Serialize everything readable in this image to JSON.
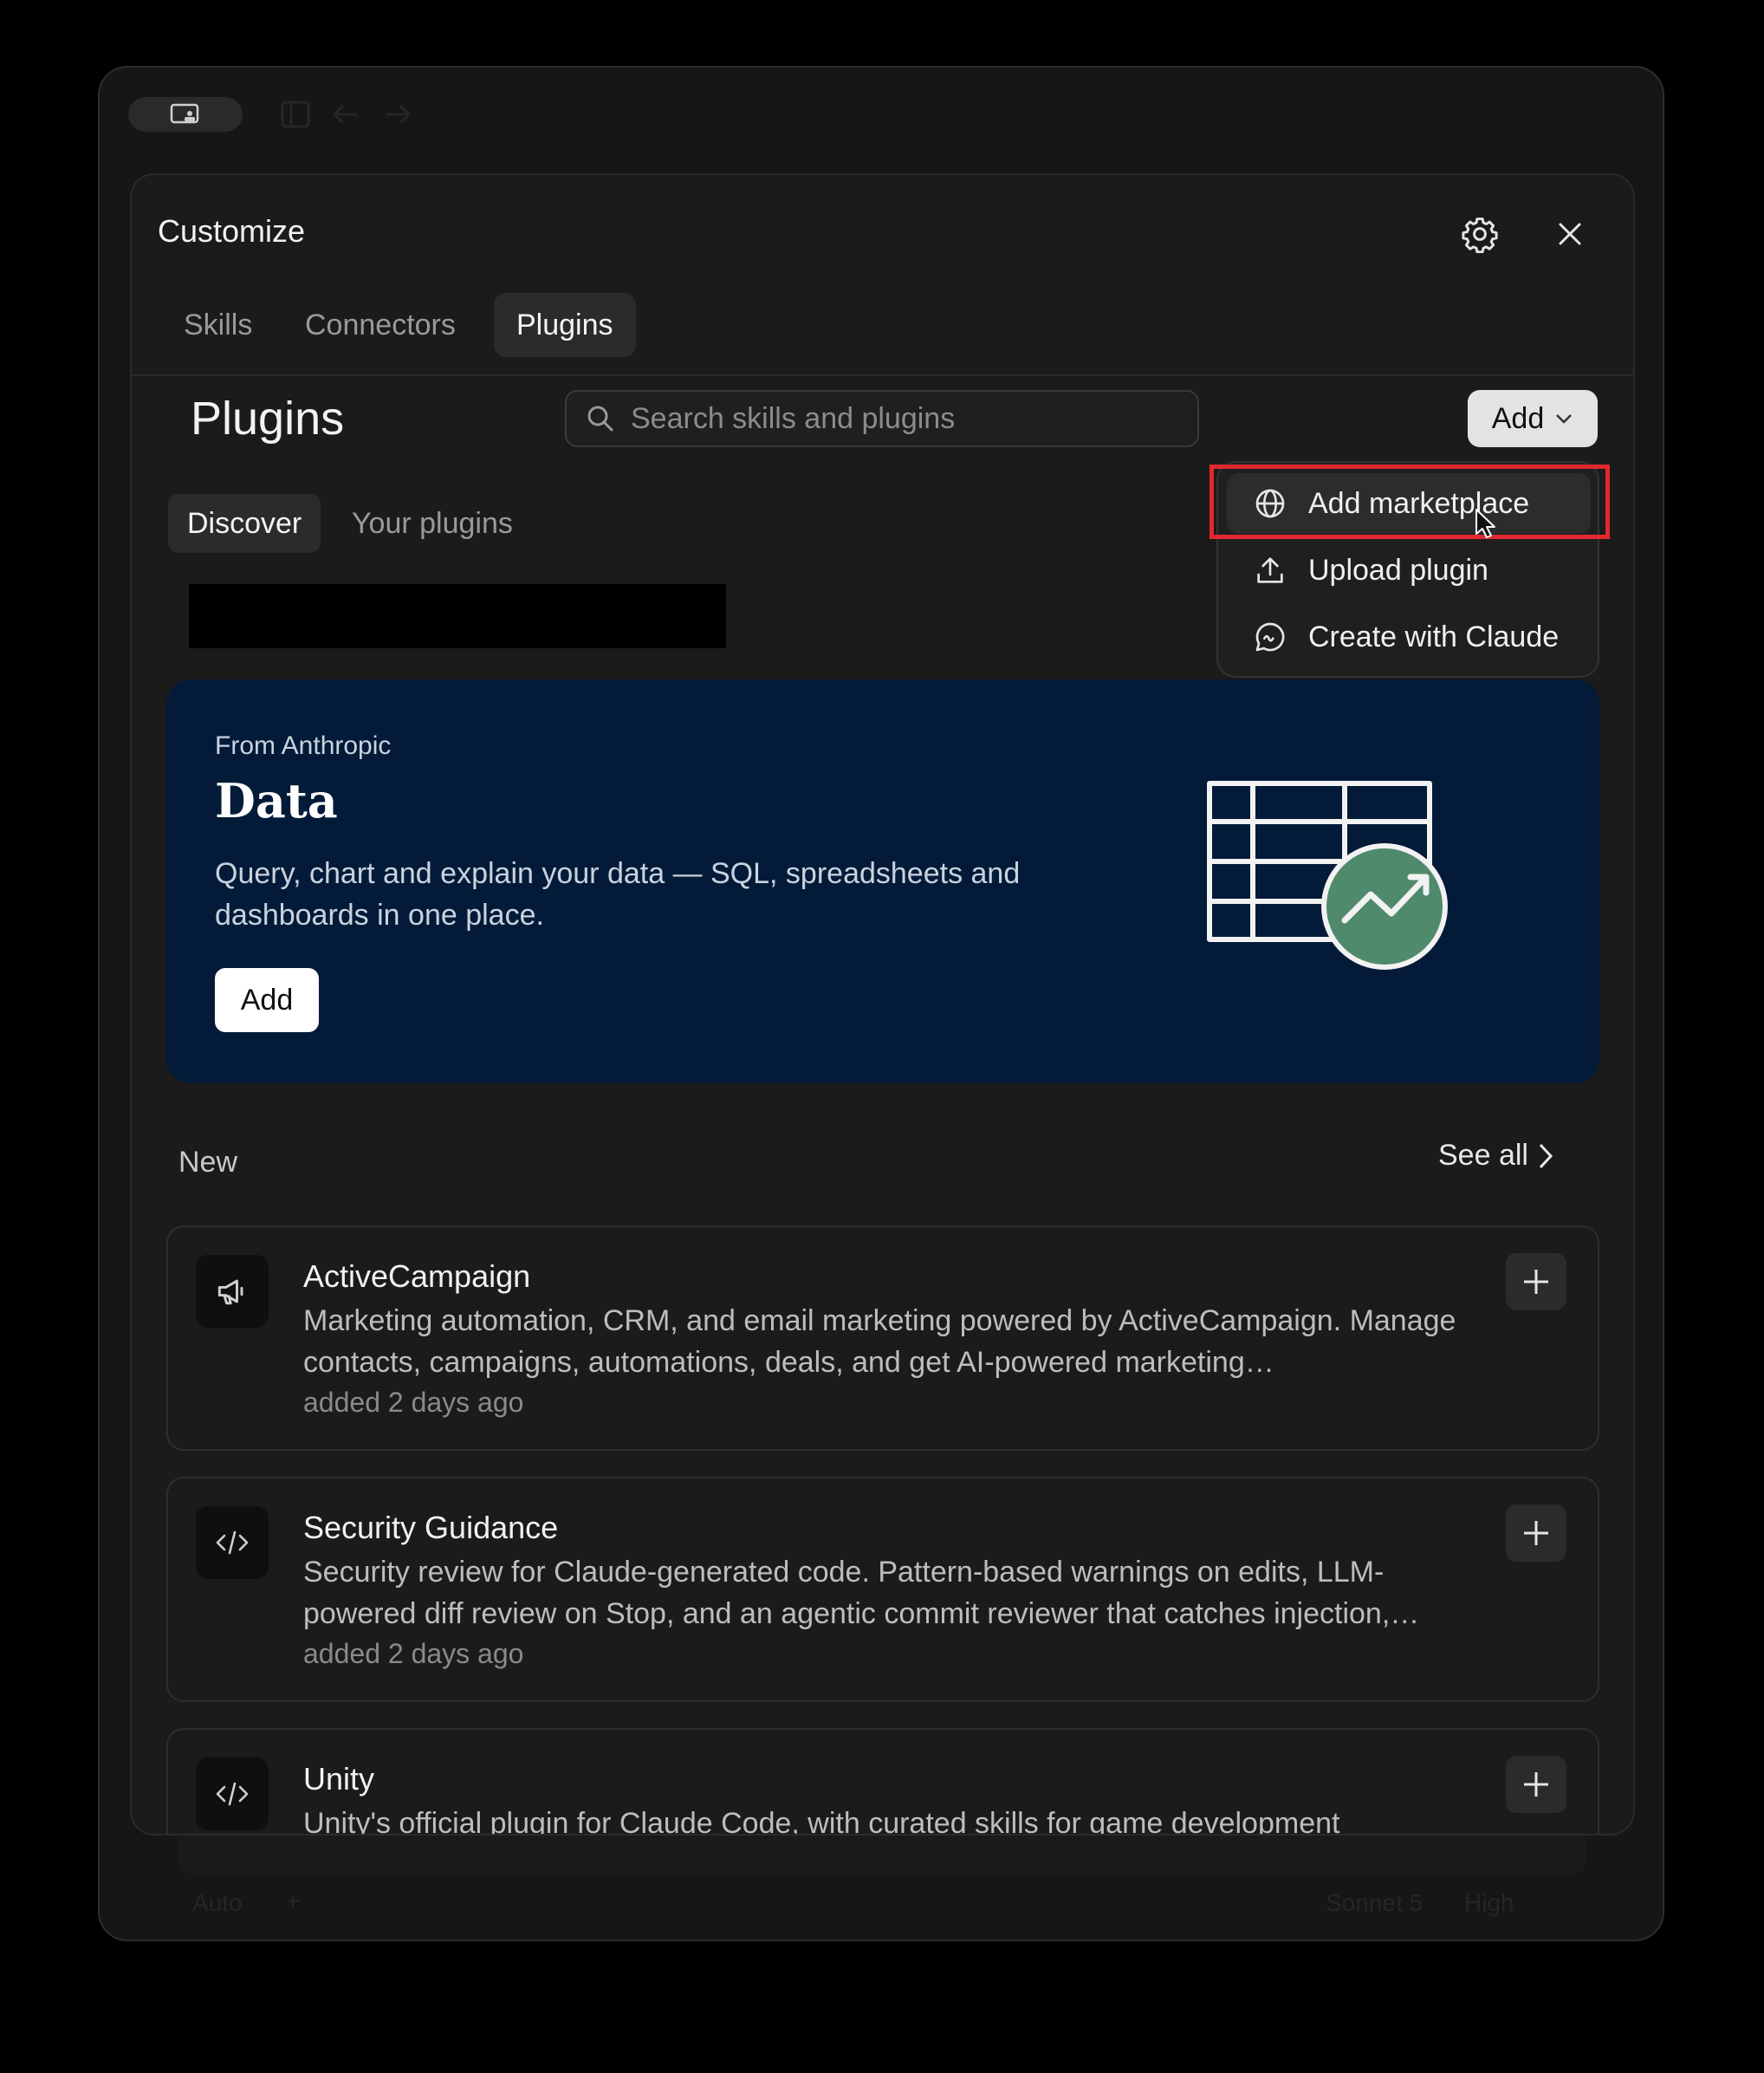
{
  "dialog": {
    "title": "Customize",
    "tabs": [
      {
        "label": "Skills",
        "active": false
      },
      {
        "label": "Connectors",
        "active": false
      },
      {
        "label": "Plugins",
        "active": true
      }
    ]
  },
  "page": {
    "heading": "Plugins",
    "search_placeholder": "Search skills and plugins",
    "add_button_label": "Add",
    "subtabs": [
      {
        "label": "Discover",
        "active": true
      },
      {
        "label": "Your plugins",
        "active": false
      }
    ]
  },
  "add_menu": {
    "items": [
      {
        "label": "Add marketplace",
        "icon": "globe-icon",
        "hovered": true
      },
      {
        "label": "Upload plugin",
        "icon": "upload-icon"
      },
      {
        "label": "Create with Claude",
        "icon": "chat-bubble-icon"
      }
    ]
  },
  "hero": {
    "eyebrow": "From Anthropic",
    "title": "Data",
    "description": "Query, chart and explain your data — SQL, spreadsheets and dashboards in one place.",
    "add_label": "Add",
    "background_color": "#031b38"
  },
  "section": {
    "title": "New",
    "see_all_label": "See all"
  },
  "plugins": [
    {
      "name": "ActiveCampaign",
      "icon": "megaphone-icon",
      "description": "Marketing automation, CRM, and email marketing powered by ActiveCampaign. Manage contacts, campaigns, automations, deals, and get AI-powered marketing…",
      "meta": "added 2 days ago"
    },
    {
      "name": "Security Guidance",
      "icon": "code-icon",
      "description": "Security review for Claude-generated code. Pattern-based warnings on edits, LLM-powered diff review on Stop, and an agentic commit reviewer that catches injection,…",
      "meta": "added 2 days ago"
    },
    {
      "name": "Unity",
      "icon": "code-icon",
      "description": "Unity's official plugin for Claude Code, with curated skills for game development",
      "meta": ""
    }
  ],
  "background_composer": {
    "left_label": "Auto",
    "model_label": "Sonnet 5",
    "effort_label": "High"
  },
  "colors": {
    "highlight": "#e0282e",
    "accent_green": "#4f8a6c"
  }
}
